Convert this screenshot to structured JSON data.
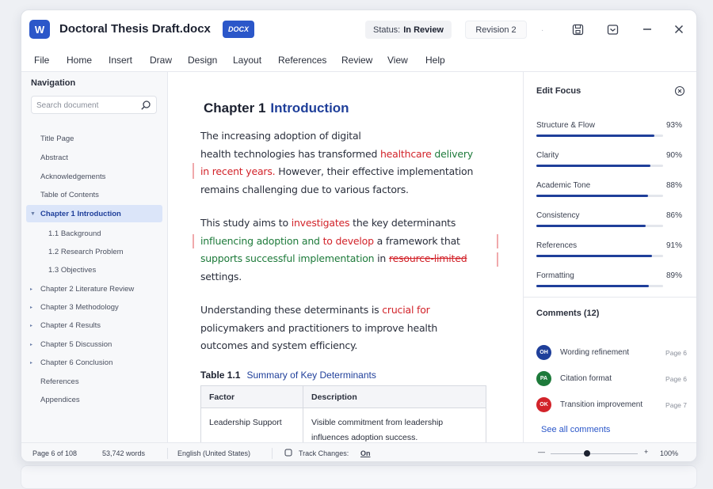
{
  "window": {
    "app_icon_text": "W",
    "doc_title": "Doctoral Thesis Draft.docx",
    "doc_badge": "DOCX",
    "status_label": "Status:",
    "status_value": "In Review",
    "revision": "Revision 2",
    "separator": "·"
  },
  "menu": [
    "File",
    "Home",
    "Insert",
    "Draw",
    "Design",
    "Layout",
    "References",
    "Review",
    "View",
    "Help"
  ],
  "navigation": {
    "title": "Navigation",
    "search_placeholder": "Search document",
    "items": [
      {
        "label": "Title Page"
      },
      {
        "label": "Abstract"
      },
      {
        "label": "Acknowledgements"
      },
      {
        "label": "Table of Contents"
      },
      {
        "label": "Chapter 1 Introduction",
        "active": true
      },
      {
        "label": "1.1 Background"
      },
      {
        "label": "1.2 Research Problem"
      },
      {
        "label": "1.3 Objectives"
      },
      {
        "label": "Chapter 2 Literature Review"
      },
      {
        "label": "Chapter 3 Methodology"
      },
      {
        "label": "Chapter 4 Results"
      },
      {
        "label": "Chapter 5 Discussion"
      },
      {
        "label": "Chapter 6 Conclusion"
      },
      {
        "label": "References"
      },
      {
        "label": "Appendices"
      }
    ]
  },
  "document": {
    "chapter_number": "Chapter 1",
    "chapter_title": "Introduction",
    "p1": {
      "l1": "The increasing adoption of digital",
      "l2_a": "health technologies has transformed ",
      "l2_red": "healthcare",
      "l2_green": " delivery",
      "l3_red": "in recent years.",
      "l3_b": " However, their effective implementation",
      "l4": "remains challenging due to various factors."
    },
    "p2": {
      "l1_a": "This study aims to ",
      "l1_red": "investigates",
      "l1_b": " the key determinants",
      "l2_green": "influencing adoption and",
      "l2_red": " to develop",
      "l2_b": " a framework that",
      "l3_green": "supports successful implementation",
      "l3_b": " in ",
      "l3_strike": "resource-limited",
      "l4": "settings."
    },
    "p3": {
      "l1_a": "Understanding these determinants is ",
      "l1_red": "crucial for",
      "l2": "policymakers and practitioners to improve health",
      "l3": "outcomes and system efficiency."
    },
    "table": {
      "caption_label": "Table 1.1",
      "caption_title": "Summary of Key Determinants",
      "headers": [
        "Factor",
        "Description"
      ],
      "rows": [
        [
          "Leadership Support",
          "Visible commitment from leadership influences adoption success."
        ]
      ]
    }
  },
  "edit_focus": {
    "title": "Edit Focus",
    "items": [
      {
        "label": "Structure & Flow",
        "value": 93,
        "display": "93%"
      },
      {
        "label": "Clarity",
        "value": 90,
        "display": "90%"
      },
      {
        "label": "Academic Tone",
        "value": 88,
        "display": "88%"
      },
      {
        "label": "Consistency",
        "value": 86,
        "display": "86%"
      },
      {
        "label": "References",
        "value": 91,
        "display": "91%"
      },
      {
        "label": "Formatting",
        "value": 89,
        "display": "89%"
      }
    ]
  },
  "comments": {
    "title": "Comments (12)",
    "items": [
      {
        "initials": "OH",
        "color": "#1f3f9a",
        "text": "Wording refinement",
        "page": "Page 6"
      },
      {
        "initials": "PA",
        "color": "#1d7a3a",
        "text": "Citation format",
        "page": "Page 6"
      },
      {
        "initials": "OK",
        "color": "#d2232a",
        "text": "Transition improvement",
        "page": "Page 7"
      }
    ],
    "see_all": "See all comments"
  },
  "statusbar": {
    "page": "Page 6 of 108",
    "words": "53,742 words",
    "language": "English (United States)",
    "track_label": "Track Changes:",
    "track_value": "On",
    "zoom_minus": "—",
    "zoom_plus": "+",
    "zoom": "100%",
    "zoom_level": 0.42
  }
}
